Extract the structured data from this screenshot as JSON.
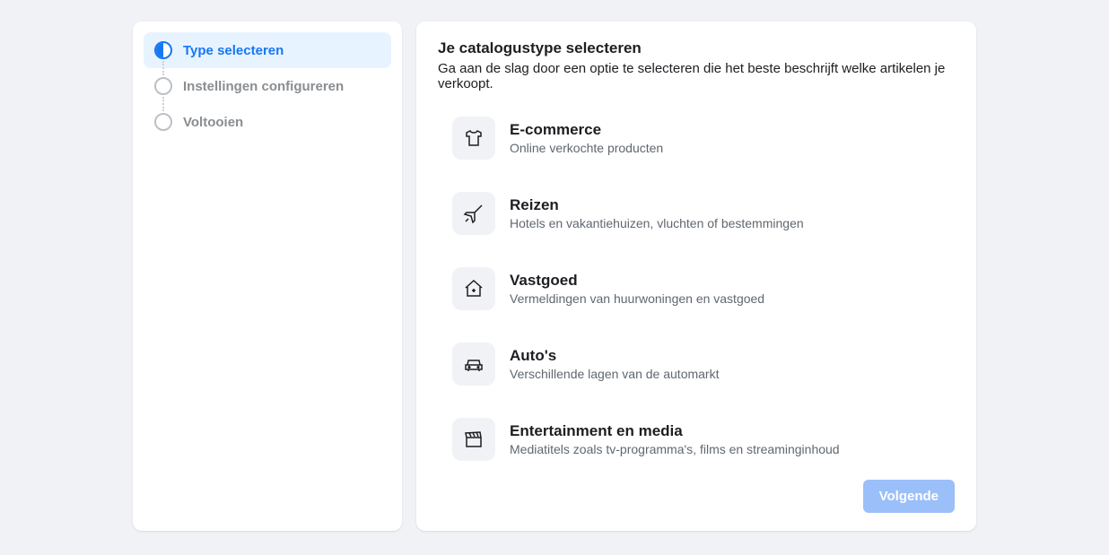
{
  "sidebar": {
    "steps": [
      {
        "label": "Type selecteren",
        "active": true
      },
      {
        "label": "Instellingen configureren",
        "active": false
      },
      {
        "label": "Voltooien",
        "active": false
      }
    ]
  },
  "main": {
    "title": "Je catalogustype selecteren",
    "subtitle": "Ga aan de slag door een optie te selecteren die het beste beschrijft welke artikelen je verkoopt."
  },
  "options": [
    {
      "title": "E-commerce",
      "desc": "Online verkochte producten"
    },
    {
      "title": "Reizen",
      "desc": "Hotels en vakantiehuizen, vluchten of bestemmingen"
    },
    {
      "title": "Vastgoed",
      "desc": "Vermeldingen van huurwoningen en vastgoed"
    },
    {
      "title": "Auto's",
      "desc": "Verschillende lagen van de automarkt"
    },
    {
      "title": "Entertainment en media",
      "desc": "Mediatitels zoals tv-programma's, films en streaminginhoud"
    }
  ],
  "footer": {
    "next_label": "Volgende"
  }
}
